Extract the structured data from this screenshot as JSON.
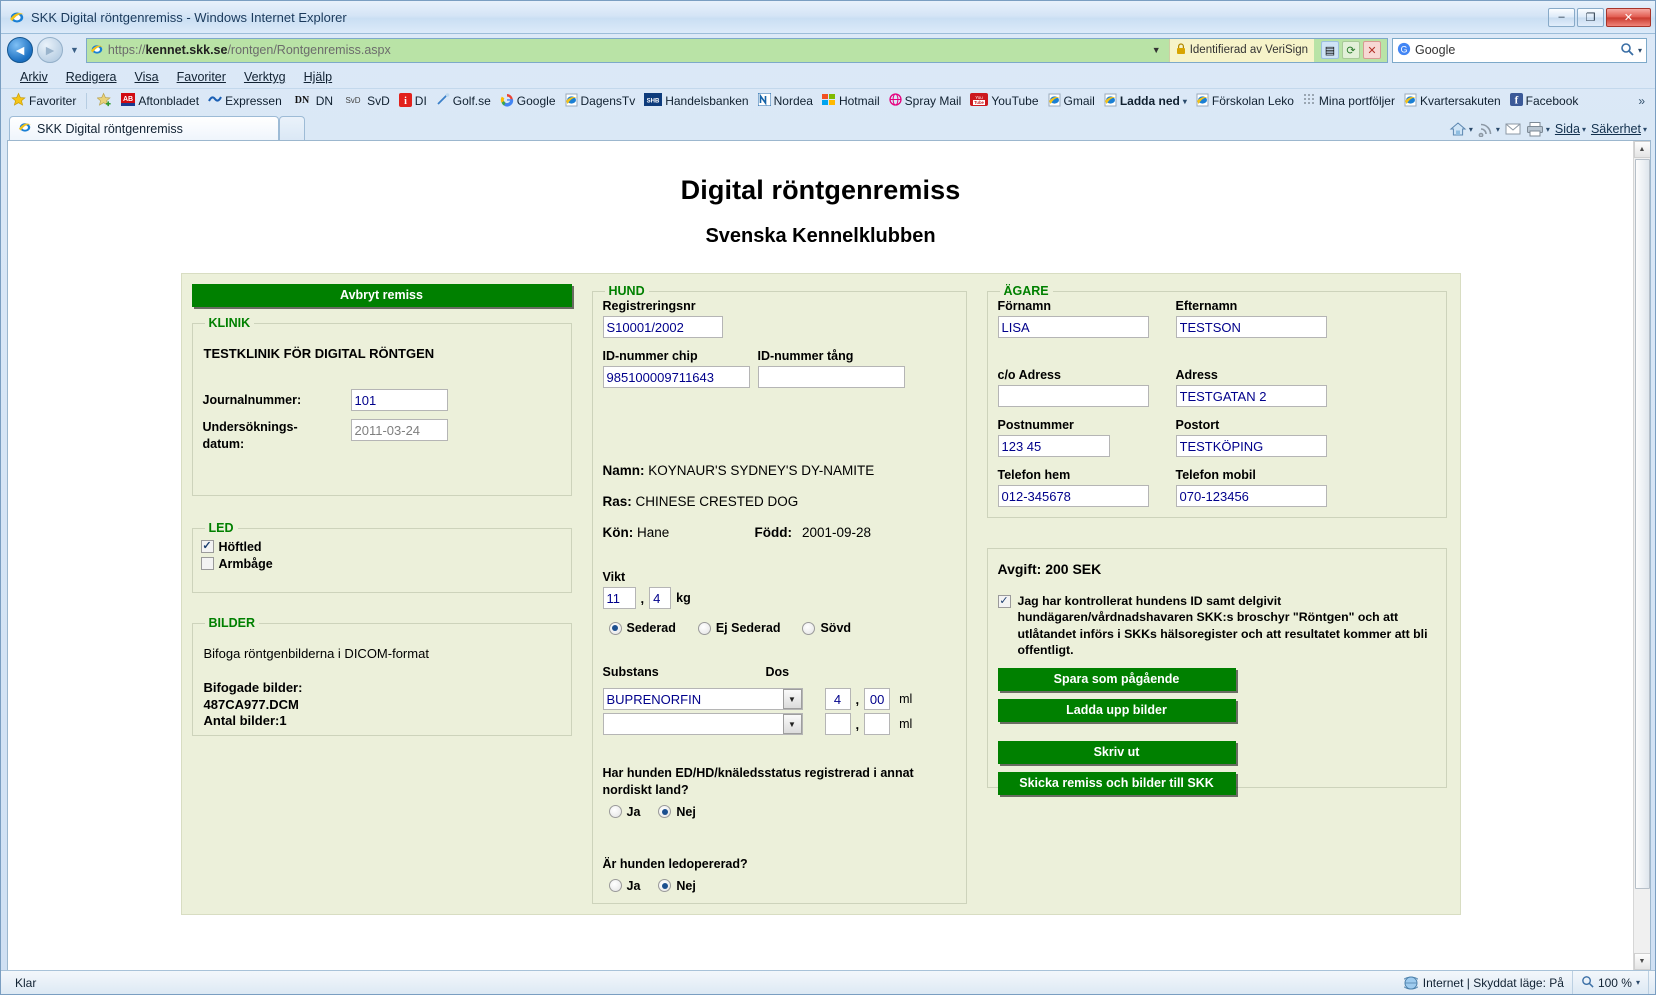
{
  "window": {
    "title": "SKK Digital röntgenremiss - Windows Internet Explorer",
    "minimize": "–",
    "maximize": "❐",
    "close": "✕"
  },
  "address": {
    "url_scheme": "https://",
    "url_host": "kennet.skk.se",
    "url_path": "/rontgen/Rontgenremiss.aspx",
    "security_label": "Identifierad av VeriSign",
    "search_value": "Google",
    "dropdown_caret": "▾"
  },
  "menubar": [
    {
      "label": "Arkiv"
    },
    {
      "label": "Redigera"
    },
    {
      "label": "Visa"
    },
    {
      "label": "Favoriter"
    },
    {
      "label": "Verktyg"
    },
    {
      "label": "Hjälp"
    }
  ],
  "favorites": {
    "button_label": "Favoriter",
    "items": [
      {
        "label": "Aftonbladet",
        "bold": false
      },
      {
        "label": "Expressen",
        "bold": false
      },
      {
        "label": "DN",
        "bold": false
      },
      {
        "label": "SvD",
        "bold": false
      },
      {
        "label": "DI",
        "bold": false
      },
      {
        "label": "Golf.se",
        "bold": false
      },
      {
        "label": "Google",
        "bold": false
      },
      {
        "label": "DagensTv",
        "bold": false
      },
      {
        "label": "Handelsbanken",
        "bold": false
      },
      {
        "label": "Nordea",
        "bold": false
      },
      {
        "label": "Hotmail",
        "bold": false
      },
      {
        "label": "Spray Mail",
        "bold": false
      },
      {
        "label": "YouTube",
        "bold": false
      },
      {
        "label": "Gmail",
        "bold": false
      },
      {
        "label": "Ladda ned",
        "bold": true
      },
      {
        "label": "Förskolan Leko",
        "bold": false
      },
      {
        "label": "Mina portföljer",
        "bold": false
      },
      {
        "label": "Kvartersakuten",
        "bold": false
      },
      {
        "label": "Facebook",
        "bold": false
      }
    ],
    "overflow": "»"
  },
  "tabs": {
    "active_tab": "SKK Digital röntgenremiss",
    "new_tab": ""
  },
  "toolbar_right": {
    "page_label": "Sida",
    "safety_label": "Säkerhet",
    "caret": "▾"
  },
  "page": {
    "title": "Digital röntgenremiss",
    "subtitle": "Svenska Kennelklubben"
  },
  "clinic": {
    "cancel_button": "Avbryt remiss",
    "legend": "KLINIK",
    "clinic_name": "TESTKLINIK FÖR DIGITAL RÖNTGEN",
    "journal_label": "Journalnummer:",
    "journal_value": "101",
    "exam_label_line1": "Undersöknings-",
    "exam_label_line2": "datum:",
    "exam_value": "2011-03-24"
  },
  "joint": {
    "legend": "LED",
    "options": [
      {
        "label": "Höftled",
        "checked": true
      },
      {
        "label": "Armbåge",
        "checked": false
      }
    ]
  },
  "images": {
    "legend": "BILDER",
    "instruction": "Bifoga röntgenbilderna i DICOM-format",
    "attached_label": "Bifogade bilder:",
    "attached_file": "487CA977.DCM",
    "count_label": "Antal bilder:1"
  },
  "dog": {
    "legend": "HUND",
    "reg_label": "Registreringsnr",
    "reg_value": "S10001/2002",
    "chip_label": "ID-nummer chip",
    "chip_value": "985100009711643",
    "tang_label": "ID-nummer tång",
    "tang_value": "",
    "name_label": "Namn:",
    "name_value": "KOYNAUR'S SYDNEY'S DY-NAMITE",
    "breed_label": "Ras:",
    "breed_value": "CHINESE CRESTED DOG",
    "sex_label": "Kön:",
    "sex_value": "Hane",
    "born_label": "Född:",
    "born_value": "2001-09-28",
    "weight_label": "Vikt",
    "weight_int": "11",
    "weight_dec": "4",
    "weight_unit": "kg",
    "weight_separator": ",",
    "sedation": [
      {
        "label": "Sederad",
        "selected": true
      },
      {
        "label": "Ej Sederad",
        "selected": false
      },
      {
        "label": "Sövd",
        "selected": false
      }
    ],
    "substance_label": "Substans",
    "dose_label": "Dos",
    "dose_unit": "ml",
    "dose_separator": ",",
    "substance_rows": [
      {
        "substance": "BUPRENORFIN",
        "dose_int": "4",
        "dose_dec": "00"
      },
      {
        "substance": "",
        "dose_int": "",
        "dose_dec": ""
      }
    ],
    "question_nordic": "Har hunden ED/HD/knäledsstatus registrerad i annat nordiskt land?",
    "nordic_options": [
      {
        "label": "Ja",
        "selected": false
      },
      {
        "label": "Nej",
        "selected": true
      }
    ],
    "question_surgery": "Är hunden ledopererad?",
    "surgery_options": [
      {
        "label": "Ja",
        "selected": false
      },
      {
        "label": "Nej",
        "selected": true
      }
    ]
  },
  "owner": {
    "legend": "ÄGARE",
    "firstname_label": "Förnamn",
    "firstname_value": "LISA",
    "lastname_label": "Efternamn",
    "lastname_value": "TESTSON",
    "co_label": "c/o Adress",
    "co_value": "",
    "address_label": "Adress",
    "address_value": "TESTGATAN 2",
    "zip_label": "Postnummer",
    "zip_value": "123 45",
    "city_label": "Postort",
    "city_value": "TESTKÖPING",
    "phone_home_label": "Telefon hem",
    "phone_home_value": "012-345678",
    "phone_mobile_label": "Telefon mobil",
    "phone_mobile_value": "070-123456"
  },
  "submit": {
    "fee_label": "Avgift: 200 SEK",
    "consent_checked": true,
    "consent_text": "Jag har kontrollerat hundens ID samt delgivit hundägaren/vårdnadshavaren SKK:s broschyr \"Röntgen\" och att utlåtandet införs i SKKs hälsoregister och att resultatet kommer att bli offentligt.",
    "buttons": [
      {
        "label": "Spara som pågående"
      },
      {
        "label": "Ladda upp bilder"
      },
      {
        "label": "Skriv ut"
      },
      {
        "label": "Skicka remiss och bilder till SKK"
      }
    ]
  },
  "statusbar": {
    "status": "Klar",
    "zone": "Internet | Skyddat läge: På",
    "zoom": "100 %",
    "caret": "▾"
  },
  "colors": {
    "accent_green": "#008000",
    "legend_green": "#008000",
    "form_bg": "#ecf0da",
    "url_bar": "#b9e3a6",
    "input_text": "#00008b"
  }
}
